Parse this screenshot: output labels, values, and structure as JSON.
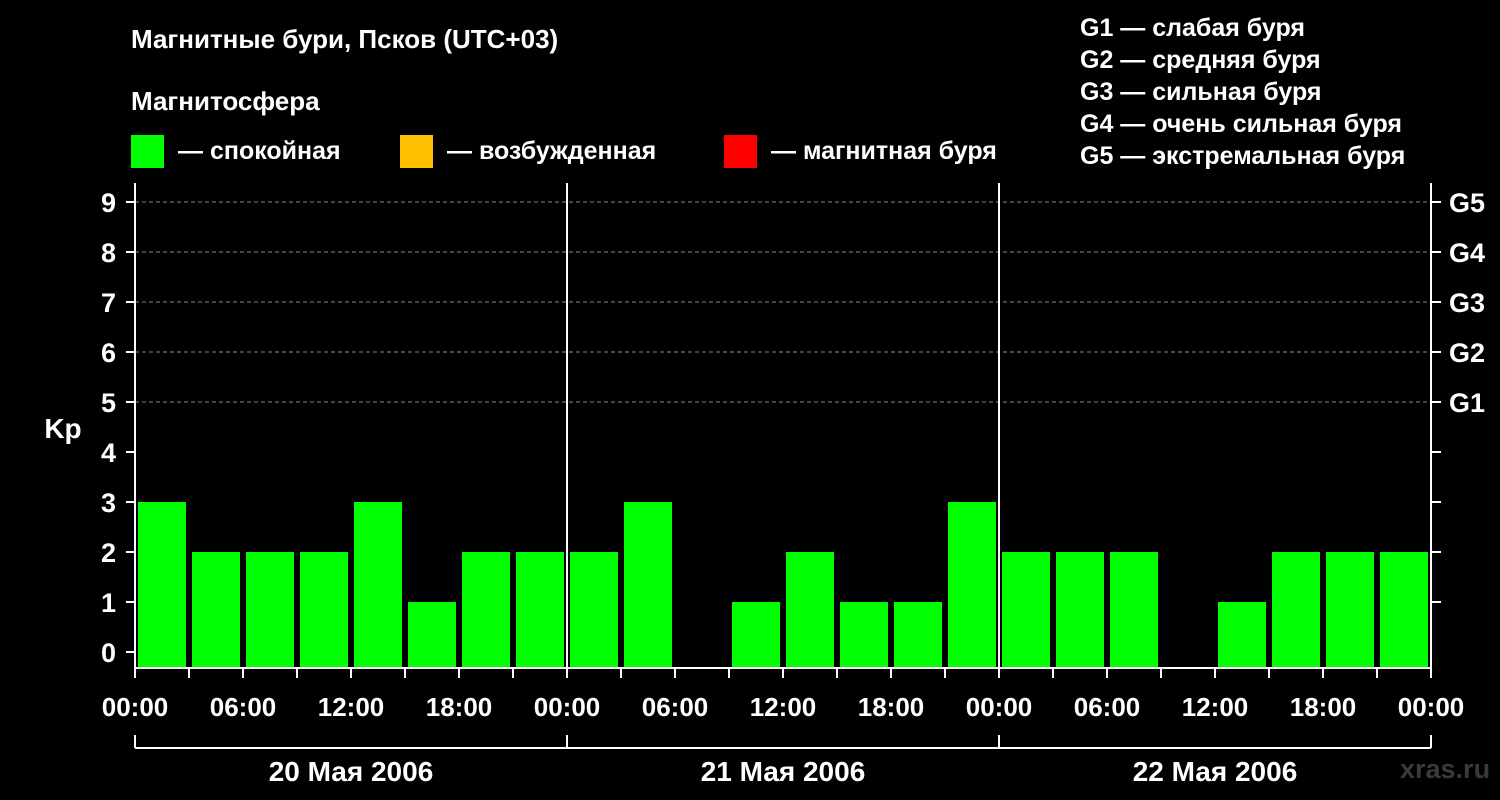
{
  "title": "Магнитные бури, Псков (UTC+03)",
  "subtitle": "Магнитосфера",
  "legend": [
    {
      "color": "#00ff00",
      "label": "— спокойная"
    },
    {
      "color": "#ffc000",
      "label": "— возбужденная"
    },
    {
      "color": "#ff0000",
      "label": "— магнитная буря"
    }
  ],
  "g_legend": [
    "G1 — слабая буря",
    "G2 — средняя буря",
    "G3 — сильная буря",
    "G4 — очень сильная буря",
    "G5 — экстремальная буря"
  ],
  "watermark": "xras.ru",
  "chart_data": {
    "type": "bar",
    "ylabel": "Kp",
    "ylim": [
      0,
      9
    ],
    "y_ticks": [
      "0",
      "1",
      "2",
      "3",
      "4",
      "5",
      "6",
      "7",
      "8",
      "9"
    ],
    "right_ticks": [
      {
        "kp": 5,
        "label": "G1"
      },
      {
        "kp": 6,
        "label": "G2"
      },
      {
        "kp": 7,
        "label": "G3"
      },
      {
        "kp": 8,
        "label": "G4"
      },
      {
        "kp": 9,
        "label": "G5"
      }
    ],
    "x_tick_labels": [
      "00:00",
      "06:00",
      "12:00",
      "18:00",
      "00:00",
      "06:00",
      "12:00",
      "18:00",
      "00:00",
      "06:00",
      "12:00",
      "18:00",
      "00:00"
    ],
    "days": [
      "20 Мая 2006",
      "21 Мая 2006",
      "22 Мая 2006"
    ],
    "bar_color": "#00ff00",
    "grid": "dashed at Kp 5–9",
    "values": [
      3,
      2,
      2,
      2,
      3,
      1,
      2,
      2,
      2,
      3,
      0,
      1,
      2,
      1,
      1,
      3,
      2,
      2,
      2,
      0,
      1,
      2,
      2,
      2
    ]
  }
}
